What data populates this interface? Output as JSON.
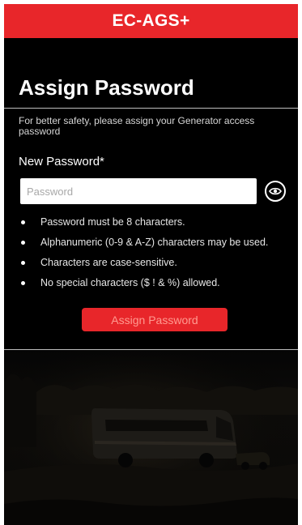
{
  "app": {
    "title": "EC-AGS+"
  },
  "page": {
    "title": "Assign Password",
    "description": "For better safety, please assign your Generator access password"
  },
  "form": {
    "password_label": "New Password*",
    "password_placeholder": "Password",
    "password_value": "",
    "submit_label": "Assign Password"
  },
  "rules": [
    "Password must be 8 characters.",
    "Alphanumeric (0-9 & A-Z) characters may be used.",
    "Characters are case-sensitive.",
    "No special characters ($ ! & %) allowed."
  ],
  "icons": {
    "visibility_toggle": "eye-icon"
  },
  "colors": {
    "brand_red": "#e8262a",
    "background": "#000000",
    "text": "#ffffff",
    "button_text": "#ff9a90"
  }
}
